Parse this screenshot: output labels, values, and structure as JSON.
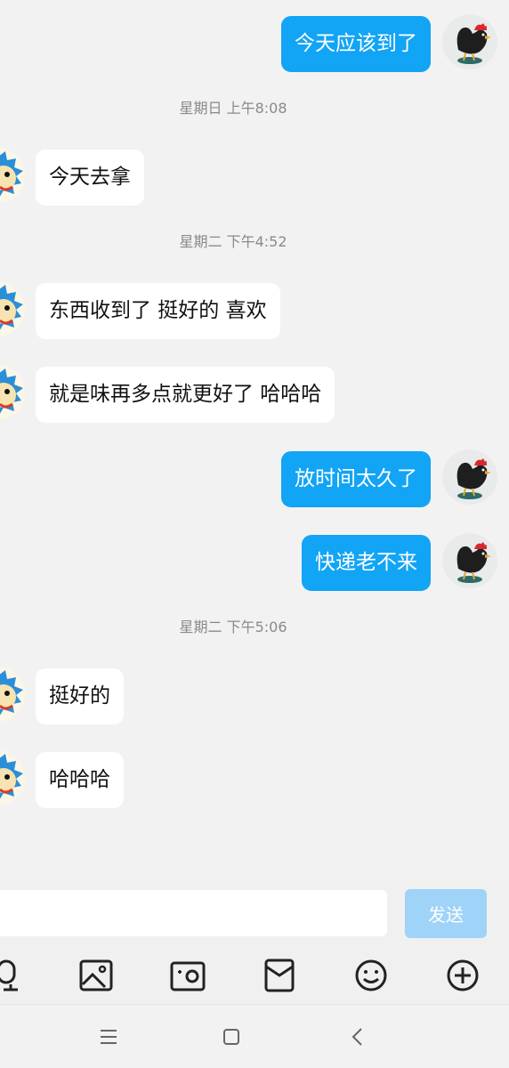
{
  "conversation": [
    {
      "kind": "message",
      "side": "out",
      "text": "今天应该到了"
    },
    {
      "kind": "time",
      "text": "星期日 上午8:08"
    },
    {
      "kind": "message",
      "side": "in",
      "text": "今天去拿"
    },
    {
      "kind": "time",
      "text": "星期二 下午4:52"
    },
    {
      "kind": "message",
      "side": "in",
      "text": "东西收到了 挺好的 喜欢"
    },
    {
      "kind": "message",
      "side": "in",
      "text": "就是味再多点就更好了 哈哈哈"
    },
    {
      "kind": "message",
      "side": "out",
      "text": "放时间太久了"
    },
    {
      "kind": "message",
      "side": "out",
      "text": "快递老不来"
    },
    {
      "kind": "time",
      "text": "星期二 下午5:06"
    },
    {
      "kind": "message",
      "side": "in",
      "text": "挺好的"
    },
    {
      "kind": "message",
      "side": "in",
      "text": "哈哈哈"
    }
  ],
  "composer": {
    "input_value": "",
    "send_label": "发送"
  },
  "toolbar": {
    "icons": [
      "microphone-icon",
      "image-icon",
      "camera-icon",
      "red-packet-icon",
      "emoji-icon",
      "plus-icon"
    ]
  },
  "navigation": {
    "icons": [
      "menu-icon",
      "home-icon",
      "back-icon"
    ]
  },
  "colors": {
    "outgoing_bubble": "#12a4f5",
    "incoming_bubble": "#ffffff",
    "send_button": "#9fd3f8",
    "background": "#f2f2f2"
  }
}
